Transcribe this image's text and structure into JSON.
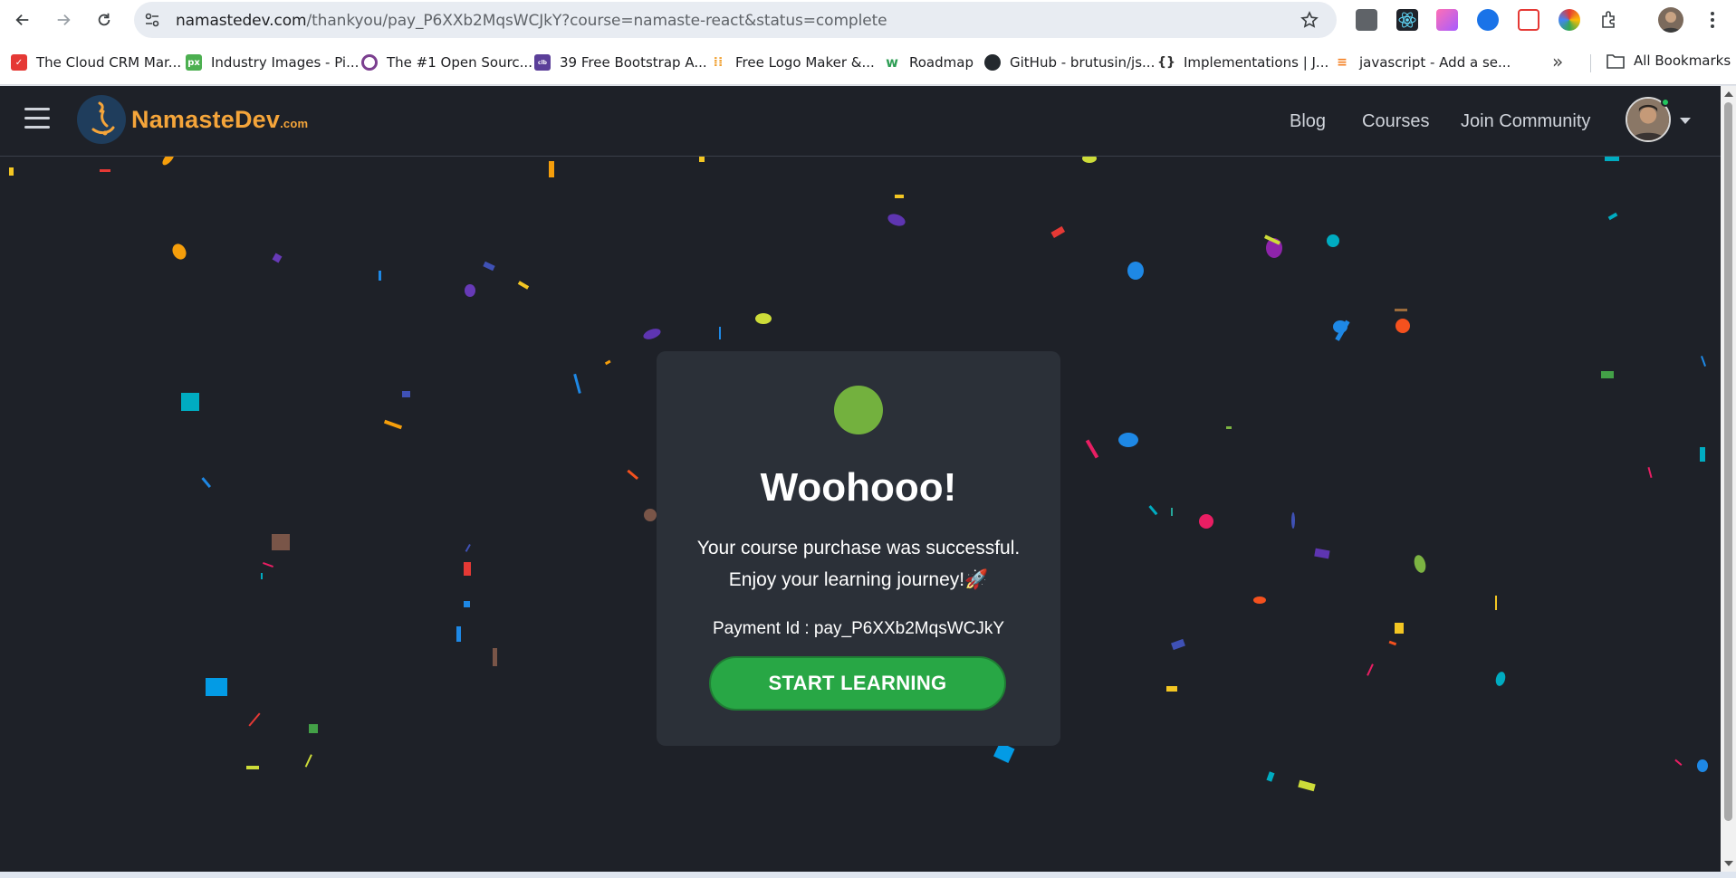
{
  "browser": {
    "url_host": "namastedev.com",
    "url_path": "/thankyou/pay_P6XXb2MqsWCJkY?course=namaste-react&status=complete",
    "bookmarks": [
      {
        "label": "The Cloud CRM Mar...",
        "color": "#e53935",
        "icon": "crm-favicon"
      },
      {
        "label": "Industry Images - Pi...",
        "color": "#4caf50",
        "icon": "pixabay-favicon"
      },
      {
        "label": "The #1 Open Sourc...",
        "color": "#7b3f8f",
        "icon": "opensource-favicon"
      },
      {
        "label": "39 Free Bootstrap A...",
        "color": "#5b3f99",
        "icon": "colorlib-favicon"
      },
      {
        "label": "Free Logo Maker &...",
        "color": "#f0a030",
        "icon": "logo-maker-favicon"
      },
      {
        "label": "Roadmap",
        "color": "#2e9e55",
        "icon": "roadmap-favicon"
      },
      {
        "label": "GitHub - brutusin/js...",
        "color": "#24292e",
        "icon": "github-favicon"
      },
      {
        "label": "Implementations | J...",
        "color": "#333333",
        "icon": "json-favicon"
      },
      {
        "label": "javascript - Add a se...",
        "color": "#f48024",
        "icon": "stackoverflow-favicon"
      }
    ],
    "more_label": "»",
    "all_bookmarks_label": "All Bookmarks"
  },
  "header": {
    "logo_text": "NamasteDev",
    "logo_suffix": ".com",
    "nav": [
      "Blog",
      "Courses",
      "Join Community"
    ]
  },
  "card": {
    "title": "Woohooo!",
    "message_line1": "Your course purchase was successful.",
    "message_line2": "Enjoy your learning journey!🚀",
    "payment_label": "Payment Id :",
    "payment_id": "pay_P6XXb2MqsWCJkY",
    "cta_label": "START LEARNING"
  },
  "colors": {
    "page_bg": "#1e2128",
    "card_bg": "#2b3038",
    "brand_orange": "#f5a53a",
    "cta_green": "#28a745",
    "success_green": "#73b13e"
  }
}
